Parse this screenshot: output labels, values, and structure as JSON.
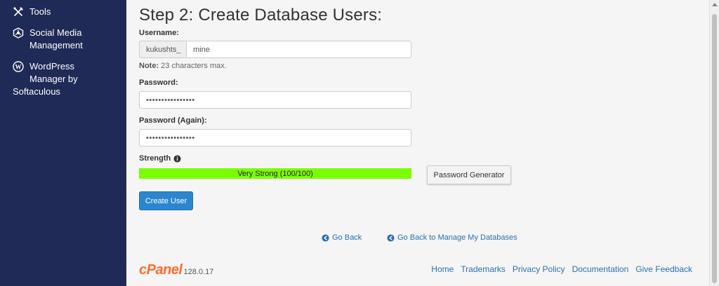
{
  "sidebar": {
    "tools": {
      "label": "Tools",
      "icon": "tools-icon"
    },
    "social": {
      "label": "Social Media Management",
      "icon": "social-media-icon"
    },
    "wordpress": {
      "line1": "WordPress",
      "line2": "Manager by",
      "line3": "Softaculous",
      "icon": "wordpress-icon"
    }
  },
  "main": {
    "title": "Step 2: Create Database Users:",
    "username": {
      "label": "Username:",
      "prefix": "kukushts_",
      "value": "mine"
    },
    "note": {
      "bold": "Note:",
      "text": " 23 characters max."
    },
    "password": {
      "label": "Password:",
      "value": "••••••••••••••••"
    },
    "password_again": {
      "label": "Password (Again):",
      "value": "••••••••••••••••"
    },
    "strength": {
      "label": "Strength",
      "text": "Very Strong (100/100)",
      "percent": 100,
      "color": "#7cfc00"
    },
    "password_generator_label": "Password Generator",
    "create_user_label": "Create User",
    "go_back_label": "Go Back",
    "go_back_manage_label": "Go Back to Manage My Databases"
  },
  "footer": {
    "logo_text": "cPanel",
    "version": "128.0.17",
    "links": [
      "Home",
      "Trademarks",
      "Privacy Policy",
      "Documentation",
      "Give Feedback"
    ]
  },
  "colors": {
    "sidebar_bg": "#1f2a56",
    "primary_button": "#2a87cf",
    "link": "#2a71b0",
    "brand": "#ff6c2c"
  }
}
